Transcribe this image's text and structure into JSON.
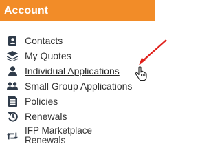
{
  "header": {
    "title": "Account"
  },
  "menu": {
    "items": [
      {
        "label": "Contacts",
        "icon": "contacts-icon"
      },
      {
        "label": "My Quotes",
        "icon": "layers-icon"
      },
      {
        "label": "Individual Applications",
        "icon": "user-icon"
      },
      {
        "label": "Small Group Applications",
        "icon": "users-icon"
      },
      {
        "label": "Policies",
        "icon": "document-icon"
      },
      {
        "label": "Renewals",
        "icon": "history-icon"
      },
      {
        "label": "IFP Marketplace Renewals",
        "icon": "retweet-icon"
      }
    ]
  },
  "colors": {
    "header_bg": "#f28c28",
    "icon": "#2f3b4a",
    "arrow": "#e0201b"
  }
}
